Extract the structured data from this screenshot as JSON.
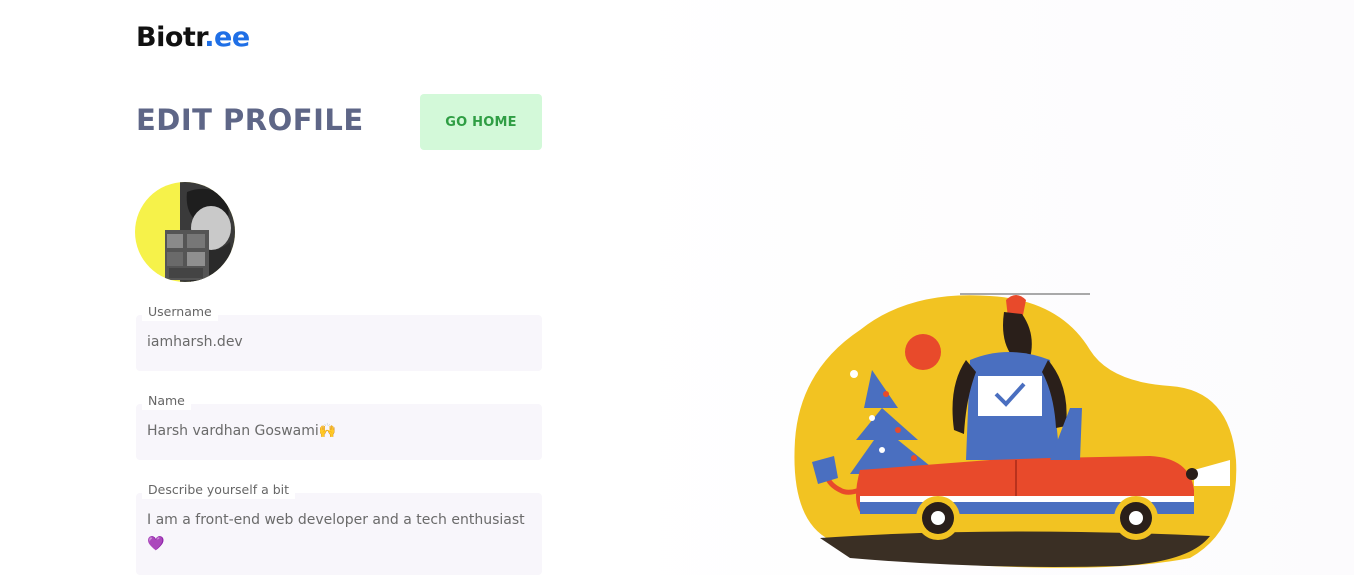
{
  "app": {
    "logo_main": "Biotr",
    "logo_accent": ".ee"
  },
  "header": {
    "title": "EDIT PROFILE",
    "go_home_label": "GO HOME"
  },
  "form": {
    "username": {
      "label": "Username",
      "value": "iamharsh.dev"
    },
    "name": {
      "label": "Name",
      "value": "Harsh vardhan Goswami🙌"
    },
    "bio": {
      "label": "Describe yourself a bit",
      "value": "I am a front-end web developer and a tech enthusiast 💜"
    }
  },
  "colors": {
    "accent": "#1f6fe6",
    "title": "#5e6687",
    "button_bg": "#d3f9d9",
    "button_text": "#2f9e44",
    "field_bg": "#f8f6fb"
  }
}
